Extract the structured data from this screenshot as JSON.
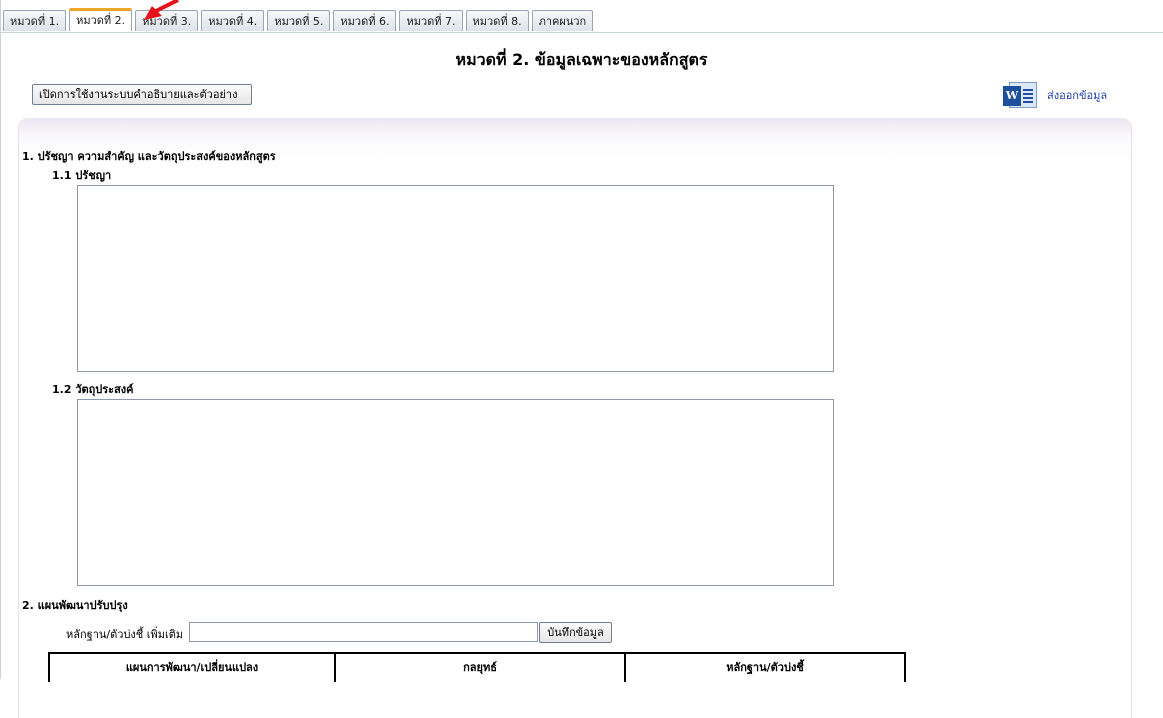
{
  "tabs": [
    {
      "label": "หมวดที่ 1."
    },
    {
      "label": "หมวดที่ 2."
    },
    {
      "label": "หมวดที่ 3."
    },
    {
      "label": "หมวดที่ 4."
    },
    {
      "label": "หมวดที่ 5."
    },
    {
      "label": "หมวดที่ 6."
    },
    {
      "label": "หมวดที่ 7."
    },
    {
      "label": "หมวดที่ 8."
    },
    {
      "label": "ภาคผนวก"
    }
  ],
  "active_tab": "หมวดที่ 2.",
  "page_title": "หมวดที่ 2. ข้อมูลเฉพาะของหลักสูตร",
  "help_button": "เปิดการใช้งานระบบคำอธิบายและตัวอย่าง",
  "export": {
    "label": "ส่งออกข้อมูล",
    "icon": "word-icon"
  },
  "section1": {
    "heading": "1. ปรัชญา ความสำคัญ และวัตถุประสงค์ของหลักสูตร",
    "sub1": "1.1 ปรัชญา",
    "sub2": "1.2 วัตถุประสงค์"
  },
  "section2": {
    "heading": "2. แผนพัฒนาปรับปรุง",
    "evidence_label": "หลักฐาน/ตัวบ่งชี้ เพิ่มเติม",
    "evidence_value": "",
    "save_button": "บันทึกข้อมูล",
    "table_headers": [
      "แผนการพัฒนา/เปลี่ยนแปลง",
      "กลยุทธ์",
      "หลักฐาน/ตัวบ่งชี้"
    ]
  },
  "colors": {
    "active_tab_accent": "#f2a529",
    "arrow": "#e8101a",
    "link": "#1f3fa8"
  }
}
